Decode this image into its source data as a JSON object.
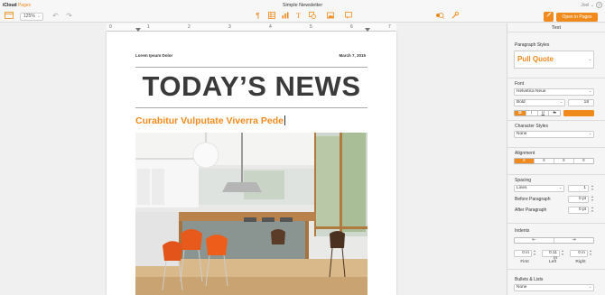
{
  "topbar": {
    "brand_icloud": "iCloud",
    "brand_app": "Pages",
    "document_title": "Simple Newsletter",
    "user_name": "Joel",
    "help_icon": "help-icon"
  },
  "toolbar": {
    "zoom_value": "125%",
    "open_in_pages_label": "Open in Pages",
    "icons": [
      "view-icon",
      "undo-icon",
      "redo-icon",
      "paragraph-icon",
      "table-icon",
      "chart-icon",
      "text-icon",
      "shape-icon",
      "media-icon",
      "comment-icon",
      "share-icon",
      "wrench-icon",
      "format-brush-icon"
    ]
  },
  "ruler": {
    "numbers": [
      "0",
      "1",
      "2",
      "3",
      "4",
      "5",
      "6",
      "7"
    ]
  },
  "document": {
    "header_left": "Lorem Ipsum Dolor",
    "header_right": "March 7, 2015",
    "headline": "TODAY’S NEWS",
    "pull_quote": "Curabitur Vulputate Viverra Pede",
    "photo": "kitchen-photo"
  },
  "sidebar": {
    "tab_label": "Text",
    "paragraph_styles_label": "Paragraph Styles",
    "paragraph_style_value": "Pull Quote",
    "font_label": "Font",
    "font_family_value": "Helvetica Neue",
    "font_weight_value": "Bold",
    "font_size_value": "18",
    "font_size_unit": "pt",
    "style_buttons": [
      "B",
      "I",
      "U",
      "S"
    ],
    "text_color": "#f08a1c",
    "character_styles_label": "Character Styles",
    "character_style_value": "None",
    "alignment_label": "Alignment",
    "spacing_label": "Spacing",
    "spacing_mode_value": "Lines",
    "spacing_value": "1",
    "before_paragraph_label": "Before Paragraph",
    "before_paragraph_value": "0 pt",
    "after_paragraph_label": "After Paragraph",
    "after_paragraph_value": "0 pt",
    "indents_label": "Indents",
    "indent_first_value": "0 in",
    "indent_left_value": "0.11 in",
    "indent_right_value": "0 in",
    "indent_first_label": "First",
    "indent_left_label": "Left",
    "indent_right_label": "Right",
    "bullets_label": "Bullets & Lists",
    "bullets_value": "None"
  },
  "colors": {
    "accent": "#f08a1c"
  }
}
